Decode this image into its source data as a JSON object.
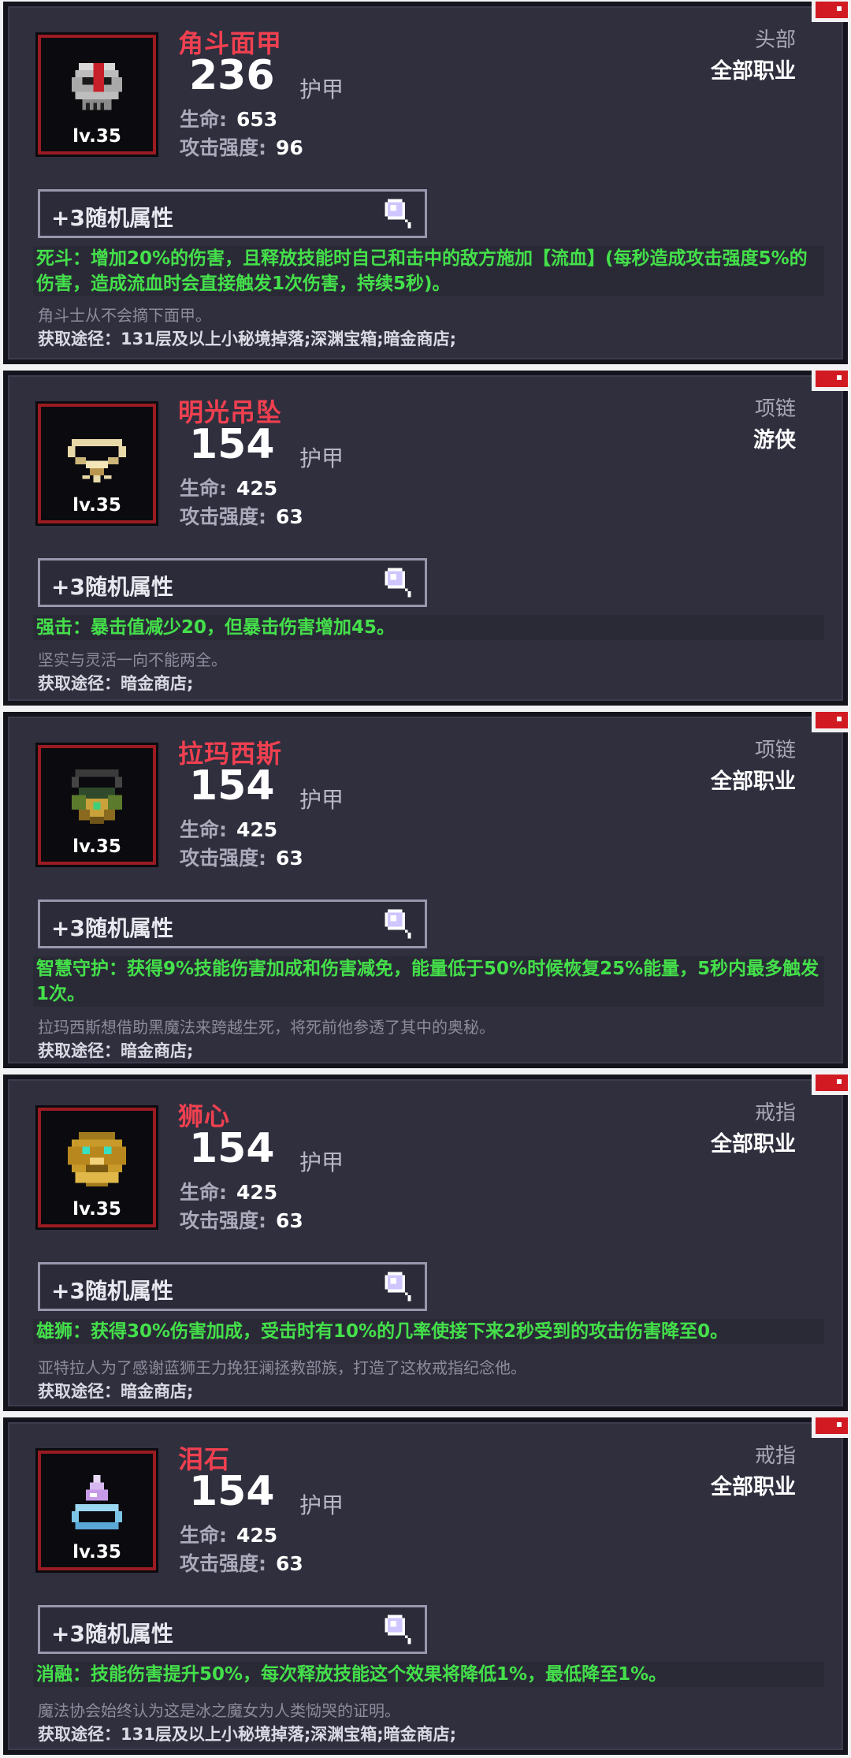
{
  "items": [
    {
      "name": "角斗面甲",
      "armor": "236",
      "armor_label": "护甲",
      "hp_label": "生命:",
      "hp": "653",
      "atk_label": "攻击强度:",
      "atk": "96",
      "slot": "头部",
      "class": "全部职业",
      "level": "lv.35",
      "random_attr": "+3随机属性",
      "effect": "死斗：增加20%的伤害，且释放技能时自己和击中的敌方施加【流血】(每秒造成攻击强度5%的伤害，造成流血时会直接触发1次伤害，持续5秒)。",
      "flavor": "角斗士从不会摘下面甲。",
      "source": "获取途径：131层及以上小秘境掉落;深渊宝箱;暗金商店;",
      "icon": "gladiator-mask-icon"
    },
    {
      "name": "明光吊坠",
      "armor": "154",
      "armor_label": "护甲",
      "hp_label": "生命:",
      "hp": "425",
      "atk_label": "攻击强度:",
      "atk": "63",
      "slot": "项链",
      "class": "游侠",
      "level": "lv.35",
      "random_attr": "+3随机属性",
      "effect": "强击：暴击值减少20，但暴击伤害增加45。",
      "flavor": "坚实与灵活一向不能两全。",
      "source": "获取途径：暗金商店;",
      "icon": "bright-pendant-icon"
    },
    {
      "name": "拉玛西斯",
      "armor": "154",
      "armor_label": "护甲",
      "hp_label": "生命:",
      "hp": "425",
      "atk_label": "攻击强度:",
      "atk": "63",
      "slot": "项链",
      "class": "全部职业",
      "level": "lv.35",
      "random_attr": "+3随机属性",
      "effect": "智慧守护：获得9%技能伤害加成和伤害减免，能量低于50%时候恢复25%能量，5秒内最多触发1次。",
      "flavor": "拉玛西斯想借助黑魔法来跨越生死，将死前他参透了其中的奥秘。",
      "source": "获取途径：暗金商店;",
      "icon": "ramasis-necklace-icon"
    },
    {
      "name": "狮心",
      "armor": "154",
      "armor_label": "护甲",
      "hp_label": "生命:",
      "hp": "425",
      "atk_label": "攻击强度:",
      "atk": "63",
      "slot": "戒指",
      "class": "全部职业",
      "level": "lv.35",
      "random_attr": "+3随机属性",
      "effect": "雄狮：获得30%伤害加成，受击时有10%的几率使接下来2秒受到的攻击伤害降至0。",
      "flavor": "亚特拉人为了感谢蓝狮王力挽狂澜拯救部族，打造了这枚戒指纪念他。",
      "source": "获取途径：暗金商店;",
      "icon": "lion-heart-ring-icon"
    },
    {
      "name": "泪石",
      "armor": "154",
      "armor_label": "护甲",
      "hp_label": "生命:",
      "hp": "425",
      "atk_label": "攻击强度:",
      "atk": "63",
      "slot": "戒指",
      "class": "全部职业",
      "level": "lv.35",
      "random_attr": "+3随机属性",
      "effect": "消融：技能伤害提升50%，每次释放技能这个效果将降低1%，最低降至1%。",
      "flavor": "魔法协会始终认为这是冰之魔女为人类恸哭的证明。",
      "source": "获取途径：131层及以上小秘境掉落;深渊宝箱;暗金商店;",
      "icon": "tear-stone-ring-icon"
    }
  ],
  "colors": {
    "name": "#f04050",
    "effect": "#44e04a",
    "frame": "#9a1b22",
    "card_bg": "#2f2f3e"
  }
}
